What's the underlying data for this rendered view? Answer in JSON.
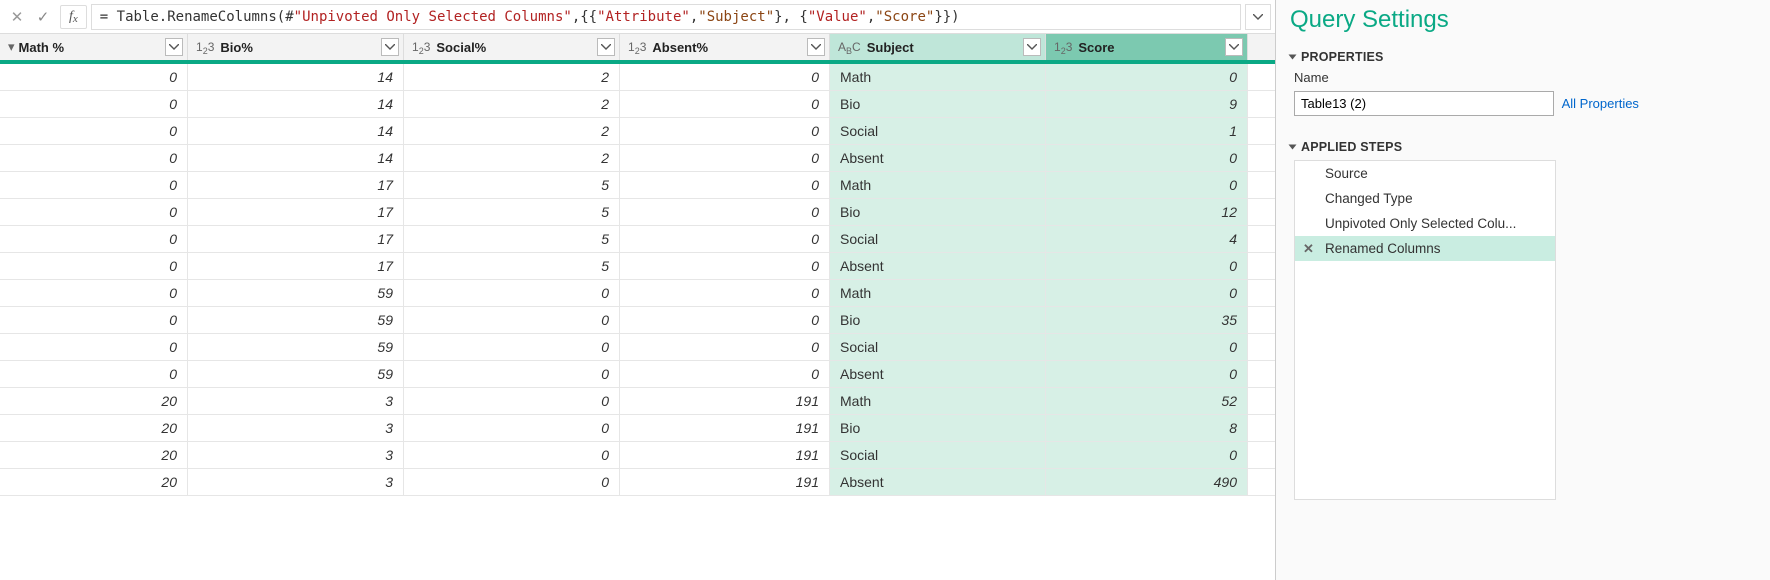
{
  "formula": {
    "prefix": "= ",
    "fn": "Table.RenameColumns",
    "ref": "#\"Unpivoted Only Selected Columns\"",
    "pairs": [
      {
        "from": "Attribute",
        "to": "Subject"
      },
      {
        "from": "Value",
        "to": "Score"
      }
    ],
    "raw_parts": [
      {
        "t": "plain",
        "v": "= Table.RenameColumns(#"
      },
      {
        "t": "strA",
        "v": "\"Unpivoted Only Selected Columns\""
      },
      {
        "t": "plain",
        "v": ",{{"
      },
      {
        "t": "strA",
        "v": "\"Attribute\""
      },
      {
        "t": "plain",
        "v": ", "
      },
      {
        "t": "strB",
        "v": "\"Subject\""
      },
      {
        "t": "plain",
        "v": "}, {"
      },
      {
        "t": "strA",
        "v": "\"Value\""
      },
      {
        "t": "plain",
        "v": ", "
      },
      {
        "t": "strB",
        "v": "\"Score\""
      },
      {
        "t": "plain",
        "v": "}})"
      }
    ]
  },
  "columns": [
    {
      "name": "Math %",
      "type": "num",
      "typeicon": "123",
      "hl": false
    },
    {
      "name": "Bio%",
      "type": "num",
      "typeicon": "123",
      "hl": false
    },
    {
      "name": "Social%",
      "type": "num",
      "typeicon": "123",
      "hl": false
    },
    {
      "name": "Absent%",
      "type": "num",
      "typeicon": "123",
      "hl": false
    },
    {
      "name": "Subject",
      "type": "text",
      "typeicon": "ABC",
      "hl": true
    },
    {
      "name": "Score",
      "type": "num",
      "typeicon": "123",
      "hl": true,
      "strong": true
    }
  ],
  "rows": [
    {
      "math": 0,
      "bio": 14,
      "social": 2,
      "absent": 0,
      "subject": "Math",
      "score": 0
    },
    {
      "math": 0,
      "bio": 14,
      "social": 2,
      "absent": 0,
      "subject": "Bio",
      "score": 9
    },
    {
      "math": 0,
      "bio": 14,
      "social": 2,
      "absent": 0,
      "subject": "Social",
      "score": 1
    },
    {
      "math": 0,
      "bio": 14,
      "social": 2,
      "absent": 0,
      "subject": "Absent",
      "score": 0
    },
    {
      "math": 0,
      "bio": 17,
      "social": 5,
      "absent": 0,
      "subject": "Math",
      "score": 0
    },
    {
      "math": 0,
      "bio": 17,
      "social": 5,
      "absent": 0,
      "subject": "Bio",
      "score": 12
    },
    {
      "math": 0,
      "bio": 17,
      "social": 5,
      "absent": 0,
      "subject": "Social",
      "score": 4
    },
    {
      "math": 0,
      "bio": 17,
      "social": 5,
      "absent": 0,
      "subject": "Absent",
      "score": 0
    },
    {
      "math": 0,
      "bio": 59,
      "social": 0,
      "absent": 0,
      "subject": "Math",
      "score": 0
    },
    {
      "math": 0,
      "bio": 59,
      "social": 0,
      "absent": 0,
      "subject": "Bio",
      "score": 35
    },
    {
      "math": 0,
      "bio": 59,
      "social": 0,
      "absent": 0,
      "subject": "Social",
      "score": 0
    },
    {
      "math": 0,
      "bio": 59,
      "social": 0,
      "absent": 0,
      "subject": "Absent",
      "score": 0
    },
    {
      "math": 20,
      "bio": 3,
      "social": 0,
      "absent": 191,
      "subject": "Math",
      "score": 52
    },
    {
      "math": 20,
      "bio": 3,
      "social": 0,
      "absent": 191,
      "subject": "Bio",
      "score": 8
    },
    {
      "math": 20,
      "bio": 3,
      "social": 0,
      "absent": 191,
      "subject": "Social",
      "score": 0
    },
    {
      "math": 20,
      "bio": 3,
      "social": 0,
      "absent": 191,
      "subject": "Absent",
      "score": 490
    }
  ],
  "settings": {
    "title": "Query Settings",
    "properties_label": "PROPERTIES",
    "name_label": "Name",
    "name_value": "Table13 (2)",
    "all_props": "All Properties",
    "steps_label": "APPLIED STEPS",
    "steps": [
      {
        "label": "Source",
        "sel": false
      },
      {
        "label": "Changed Type",
        "sel": false
      },
      {
        "label": "Unpivoted Only Selected Colu...",
        "sel": false
      },
      {
        "label": "Renamed Columns",
        "sel": true
      }
    ]
  }
}
